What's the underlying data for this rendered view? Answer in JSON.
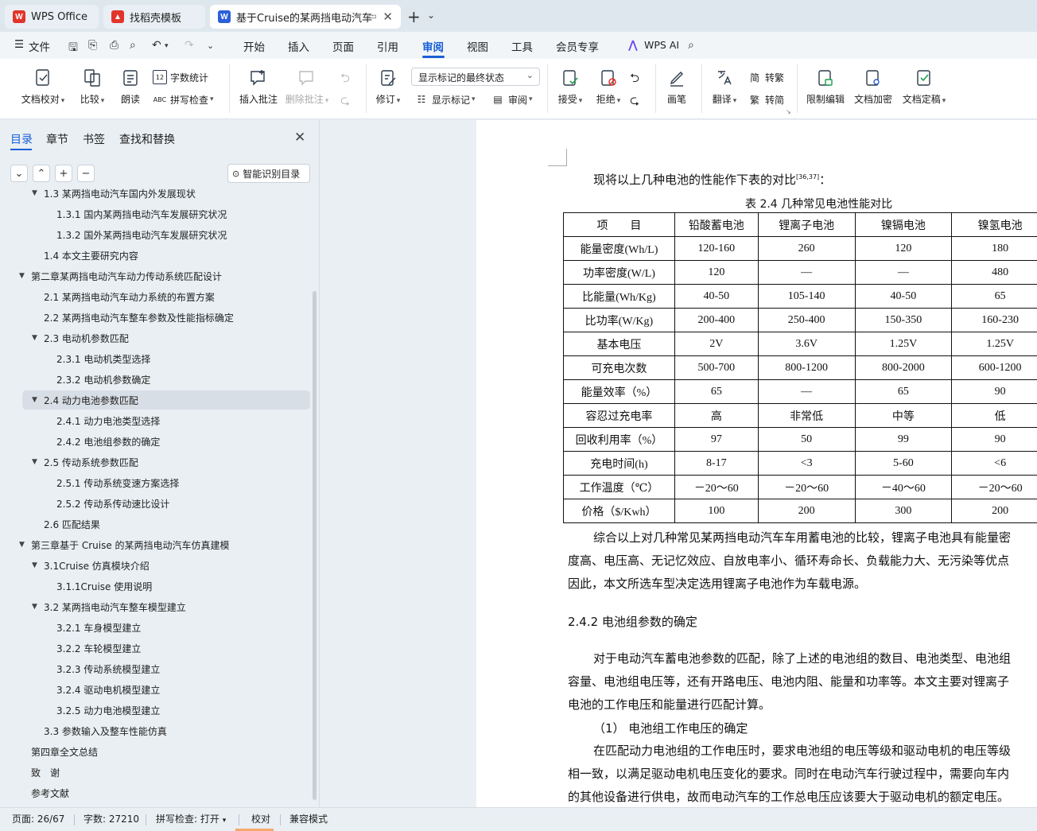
{
  "tabs": [
    {
      "label": "WPS Office",
      "icon": "wps-logo-icon"
    },
    {
      "label": "找稻壳模板",
      "icon": "docer-icon"
    },
    {
      "label": "基于Cruise的某两挡电动汽车f",
      "icon": "word-doc-icon"
    }
  ],
  "menu": {
    "file_label": "文件",
    "items": [
      "开始",
      "插入",
      "页面",
      "引用",
      "审阅",
      "视图",
      "工具",
      "会员专享"
    ],
    "active": "审阅",
    "ai_label": "WPS AI"
  },
  "ribbon": {
    "doc_proof": "文档校对",
    "compare": "比较",
    "read_aloud": "朗读",
    "word_count": "字数统计",
    "spell_check": "拼写检查",
    "insert_comment": "插入批注",
    "delete_comment": "删除批注",
    "revise": "修订",
    "show_state": "显示标记的最终状态",
    "show_marks": "显示标记",
    "review": "审阅",
    "accept": "接受",
    "reject": "拒绝",
    "pen": "画笔",
    "translate": "翻译",
    "to_traditional": "转繁",
    "to_simplified": "转简",
    "restrict_edit": "限制编辑",
    "encrypt": "文档加密",
    "finalize": "文档定稿"
  },
  "panel": {
    "tabs": [
      "目录",
      "章节",
      "书签",
      "查找和替换"
    ],
    "smart_toc": "智能识别目录",
    "toc": [
      {
        "label": "1.3 某两挡电动汽车国内外发展现状",
        "level": 2,
        "expanded": true
      },
      {
        "label": "1.3.1 国内某两挡电动汽车发展研究状况",
        "level": 3
      },
      {
        "label": "1.3.2 国外某两挡电动汽车发展研究状况",
        "level": 3
      },
      {
        "label": "1.4 本文主要研究内容",
        "level": 2
      },
      {
        "label": "第二章某两挡电动汽车动力传动系统匹配设计",
        "level": 1,
        "expanded": true
      },
      {
        "label": "2.1 某两挡电动汽车动力系统的布置方案",
        "level": 2
      },
      {
        "label": "2.2 某两挡电动汽车整车参数及性能指标确定",
        "level": 2
      },
      {
        "label": "2.3 电动机参数匹配",
        "level": 2,
        "expanded": true
      },
      {
        "label": "2.3.1 电动机类型选择",
        "level": 3
      },
      {
        "label": "2.3.2 电动机参数确定",
        "level": 3
      },
      {
        "label": "2.4 动力电池参数匹配",
        "level": 2,
        "expanded": true,
        "selected": true
      },
      {
        "label": "2.4.1 动力电池类型选择",
        "level": 3
      },
      {
        "label": "2.4.2 电池组参数的确定",
        "level": 3
      },
      {
        "label": "2.5 传动系统参数匹配",
        "level": 2,
        "expanded": true
      },
      {
        "label": "2.5.1 传动系统变速方案选择",
        "level": 3
      },
      {
        "label": "2.5.2 传动系传动速比设计",
        "level": 3
      },
      {
        "label": "2.6 匹配结果",
        "level": 2
      },
      {
        "label": "第三章基于 Cruise 的某两挡电动汽车仿真建模",
        "level": 1,
        "expanded": true
      },
      {
        "label": "3.1Cruise 仿真模块介绍",
        "level": 2,
        "expanded": true
      },
      {
        "label": "3.1.1Cruise 使用说明",
        "level": 3
      },
      {
        "label": "3.2 某两挡电动汽车整车模型建立",
        "level": 2,
        "expanded": true
      },
      {
        "label": "3.2.1 车身模型建立",
        "level": 3
      },
      {
        "label": "3.2.2 车轮模型建立",
        "level": 3
      },
      {
        "label": "3.2.3 传动系统模型建立",
        "level": 3
      },
      {
        "label": "3.2.4 驱动电机模型建立",
        "level": 3
      },
      {
        "label": "3.2.5 动力电池模型建立",
        "level": 3
      },
      {
        "label": "3.3 参数输入及整车性能仿真",
        "level": 2
      },
      {
        "label": "第四章全文总结",
        "level": 1
      },
      {
        "label": "致　谢",
        "level": 1
      },
      {
        "label": "参考文献",
        "level": 1
      }
    ]
  },
  "doc": {
    "intro": "现将以上几种电池的性能作下表的对比",
    "intro_ref": "[36,37]",
    "intro_tail": "：",
    "table_caption": "表 2.4 几种常见电池性能对比",
    "table_header": [
      "项　　目",
      "铅酸蓄电池",
      "锂离子电池",
      "镍镉电池",
      "镍氢电池"
    ],
    "table_rows": [
      [
        "能量密度(Wh/L)",
        "120-160",
        "260",
        "120",
        "180"
      ],
      [
        "功率密度(W/L)",
        "120",
        "—",
        "—",
        "480"
      ],
      [
        "比能量(Wh/Kg)",
        "40-50",
        "105-140",
        "40-50",
        "65"
      ],
      [
        "比功率(W/Kg)",
        "200-400",
        "250-400",
        "150-350",
        "160-230"
      ],
      [
        "基本电压",
        "2V",
        "3.6V",
        "1.25V",
        "1.25V"
      ],
      [
        "可充电次数",
        "500-700",
        "800-1200",
        "800-2000",
        "600-1200"
      ],
      [
        "能量效率（%）",
        "65",
        "—",
        "65",
        "90"
      ],
      [
        "容忍过充电率",
        "高",
        "非常低",
        "中等",
        "低"
      ],
      [
        "回收利用率（%）",
        "97",
        "50",
        "99",
        "90"
      ],
      [
        "充电时间(h)",
        "8-17",
        "<3",
        "5-60",
        "<6"
      ],
      [
        "工作温度（℃）",
        "－20～60",
        "－20～60",
        "－40～60",
        "－20～60"
      ],
      [
        "价格（$/Kwh）",
        "100",
        "200",
        "300",
        "200"
      ]
    ],
    "para1_l1": "综合以上对几种常见某两挡电动汽车车用蓄电池的比较，锂离子电池具有能量密",
    "para1_l2": "度高、电压高、无记忆效应、自放电率小、循环寿命长、负载能力大、无污染等优点",
    "para1_l3": "因此，本文所选车型决定选用锂离子电池作为车载电源。",
    "heading": "2.4.2 电池组参数的确定",
    "para2_l1": "对于电动汽车蓄电池参数的匹配，除了上述的电池组的数目、电池类型、电池组",
    "para2_l2": "容量、电池组电压等，还有开路电压、电池内阻、能量和功率等。本文主要对锂离子",
    "para2_l3": "电池的工作电压和能量进行匹配计算。",
    "item1": "（1）  电池组工作电压的确定",
    "para3_l1": "在匹配动力电池组的工作电压时，要求电池组的电压等级和驱动电机的电压等级",
    "para3_l2": "相一致，以满足驱动电机电压变化的要求。同时在电动汽车行驶过程中，需要向车内",
    "para3_l3": "的其他设备进行供电，故而电动汽车的工作总电压应该要大于驱动电机的额定电压。"
  },
  "status": {
    "page": "页面: 26/67",
    "words": "字数: 27210",
    "spell": "拼写检查: 打开",
    "proof": "校对",
    "compat": "兼容模式"
  },
  "colors": {
    "accent": "#1a5fd6",
    "wps_red": "#e0352b",
    "word_blue": "#2b5fd9"
  }
}
